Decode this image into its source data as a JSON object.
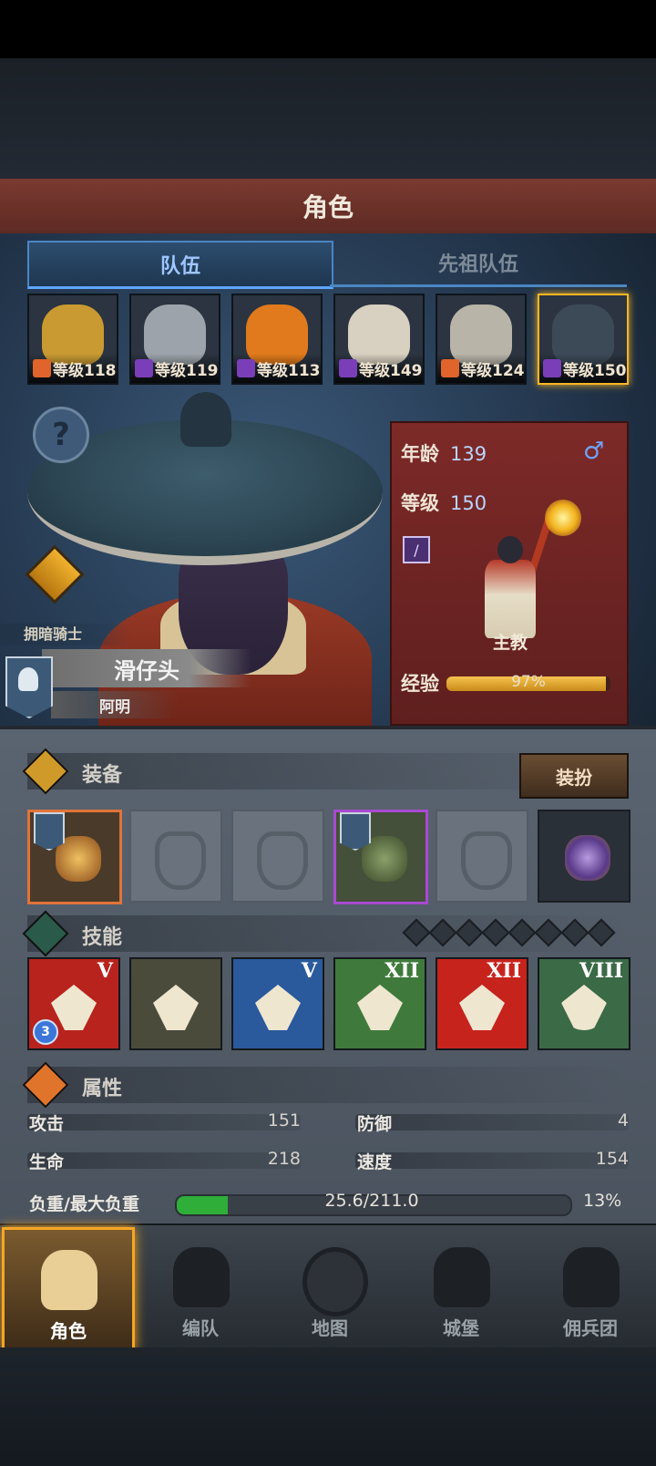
{
  "header": {
    "title": "角色"
  },
  "tabs": [
    {
      "label": "队伍",
      "active": true
    },
    {
      "label": "先祖队伍",
      "active": false
    }
  ],
  "party": [
    {
      "level": "等级118",
      "class_icon": "horse-rider-icon",
      "class_color": "#e0642b",
      "face_color": "#c99a32"
    },
    {
      "level": "等级119",
      "class_icon": "staff-icon",
      "class_color": "#7a3fb8",
      "face_color": "#9ca3aa"
    },
    {
      "level": "等级113",
      "class_icon": "staff-icon",
      "class_color": "#7a3fb8",
      "face_color": "#e07a1c"
    },
    {
      "level": "等级149",
      "class_icon": "staff-icon",
      "class_color": "#7a3fb8",
      "face_color": "#d8d0c0"
    },
    {
      "level": "等级124",
      "class_icon": "horse-rider-icon",
      "class_color": "#e0642b",
      "face_color": "#b8b4a8"
    },
    {
      "level": "等级150",
      "class_icon": "staff-icon",
      "class_color": "#7a3fb8",
      "face_color": "#3c4a58",
      "selected": true
    }
  ],
  "hero": {
    "class_title": "拥暗骑士",
    "name": "滑仔头",
    "nickname": "阿明"
  },
  "info": {
    "age_label": "年龄",
    "age": "139",
    "level_label": "等级",
    "level": "150",
    "gender_symbol": "♂",
    "class_label": "主教",
    "exp_label": "经验",
    "exp_text": "97%",
    "exp_fraction": 0.97
  },
  "equipment": {
    "title": "装备",
    "dress_button": "装扮",
    "slots": [
      {
        "name": "weapon-slot",
        "state": "equipped"
      },
      {
        "name": "shield-slot",
        "state": "empty"
      },
      {
        "name": "helmet-slot",
        "state": "empty"
      },
      {
        "name": "armor-slot",
        "state": "equipped"
      },
      {
        "name": "boots-slot",
        "state": "empty"
      },
      {
        "name": "trinket-slot",
        "state": "equipped"
      }
    ]
  },
  "skills": {
    "title": "技能",
    "items": [
      {
        "rank": "V",
        "color": "#b8231d",
        "badge": "3"
      },
      {
        "rank": "",
        "color": "#4b4b3c"
      },
      {
        "rank": "V",
        "color": "#2a5a9c"
      },
      {
        "rank": "XII",
        "color": "#3f7a3c"
      },
      {
        "rank": "XII",
        "color": "#c7231d"
      },
      {
        "rank": "VIII",
        "color": "#3a6a46"
      }
    ]
  },
  "attributes": {
    "title": "属性",
    "attack_label": "攻击",
    "attack": "151",
    "defense_label": "防御",
    "defense": "4",
    "life_label": "生命",
    "life": "218",
    "speed_label": "速度",
    "speed": "154",
    "load_label": "负重/最大负重",
    "load": "25.6/211.0",
    "load_pct": "13%",
    "load_fraction": 0.13
  },
  "nav": [
    {
      "label": "角色",
      "active": true
    },
    {
      "label": "编队"
    },
    {
      "label": "地图"
    },
    {
      "label": "城堡"
    },
    {
      "label": "佣兵团"
    }
  ]
}
